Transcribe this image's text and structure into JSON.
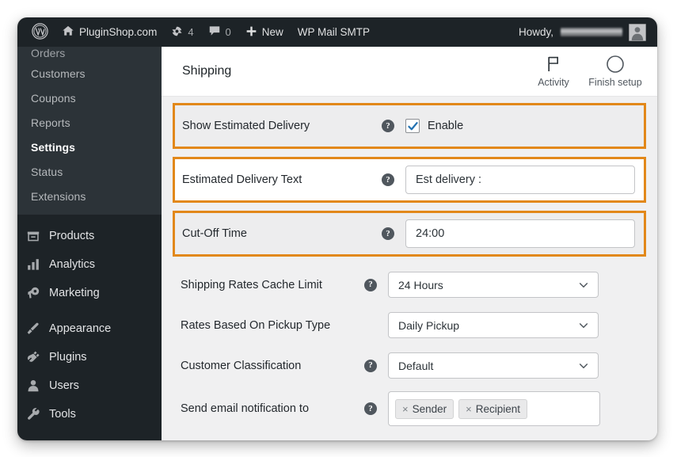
{
  "adminbar": {
    "site_name": "PluginShop.com",
    "wp_logo_icon": "wordpress-logo-icon",
    "home_icon": "home-icon",
    "updates_icon": "updates-icon",
    "updates_count": "4",
    "comments_icon": "comment-bubble-icon",
    "comments_count": "0",
    "new_icon": "plus-icon",
    "new_label": "New",
    "plugin_label": "WP Mail SMTP",
    "howdy_label": "Howdy,",
    "howdy_user_redacted": "",
    "avatar_icon": "avatar-icon"
  },
  "sidebar": {
    "submenu": [
      {
        "label": "Orders",
        "current": false
      },
      {
        "label": "Customers",
        "current": false
      },
      {
        "label": "Coupons",
        "current": false
      },
      {
        "label": "Reports",
        "current": false
      },
      {
        "label": "Settings",
        "current": true
      },
      {
        "label": "Status",
        "current": false
      },
      {
        "label": "Extensions",
        "current": false
      }
    ],
    "menu": [
      {
        "label": "Products",
        "icon": "products-icon"
      },
      {
        "label": "Analytics",
        "icon": "analytics-bar-chart-icon"
      },
      {
        "label": "Marketing",
        "icon": "megaphone-icon"
      },
      {
        "label": "Appearance",
        "icon": "paintbrush-icon"
      },
      {
        "label": "Plugins",
        "icon": "plug-icon"
      },
      {
        "label": "Users",
        "icon": "user-icon"
      },
      {
        "label": "Tools",
        "icon": "wrench-icon"
      }
    ]
  },
  "topbar": {
    "title": "Shipping",
    "activity_label": "Activity",
    "activity_icon": "flag-icon",
    "finish_setup_label": "Finish setup",
    "finish_setup_icon": "progress-circle-icon"
  },
  "settings": {
    "rows": [
      {
        "label": "Show Estimated Delivery",
        "has_help": true,
        "control": "checkbox",
        "checked": true,
        "checkbox_label": "Enable",
        "highlighted": true
      },
      {
        "label": "Estimated Delivery Text",
        "has_help": true,
        "control": "text",
        "value": "Est delivery :",
        "highlighted": true
      },
      {
        "label": "Cut-Off Time",
        "has_help": true,
        "control": "text",
        "value": "24:00",
        "highlighted": true
      },
      {
        "label": "Shipping Rates Cache Limit",
        "has_help": true,
        "control": "select",
        "value": "24 Hours",
        "highlighted": false
      },
      {
        "label": "Rates Based On Pickup Type",
        "has_help": false,
        "control": "select",
        "value": "Daily Pickup",
        "highlighted": false
      },
      {
        "label": "Customer Classification",
        "has_help": true,
        "control": "select",
        "value": "Default",
        "highlighted": false
      },
      {
        "label": "Send email notification to",
        "has_help": true,
        "control": "tags",
        "tags": [
          "Sender",
          "Recipient"
        ],
        "tag_remove_glyph": "×",
        "highlighted": false
      }
    ],
    "help_glyph": "?"
  },
  "colors": {
    "highlight_orange": "#e2881a",
    "admin_dark": "#1d2327",
    "submenu_dark": "#2c3338",
    "content_bg": "#f0f0f1",
    "checkbox_blue": "#2271b1"
  }
}
